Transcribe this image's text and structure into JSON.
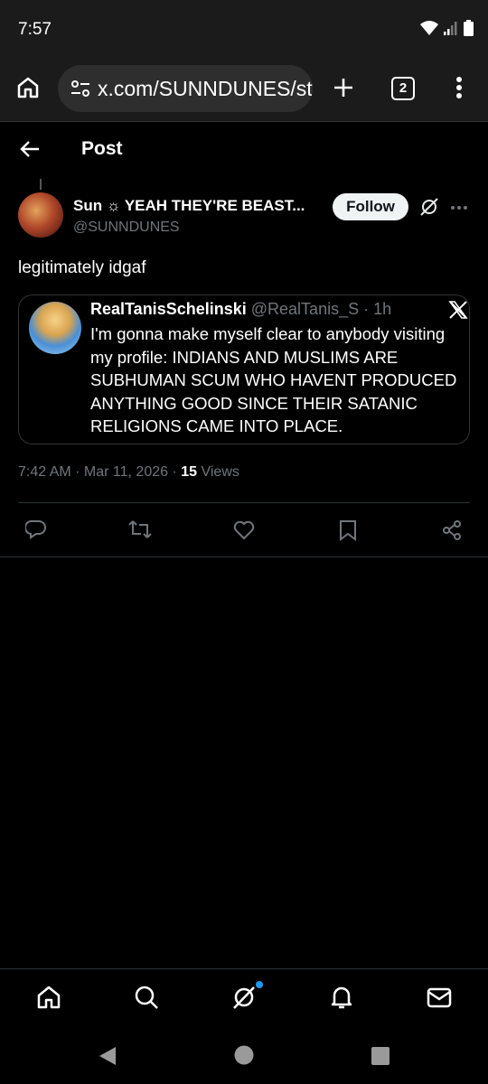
{
  "status": {
    "time": "7:57"
  },
  "browser": {
    "url": "x.com/SUNNDUNES/status",
    "tab_count": "2"
  },
  "header": {
    "title": "Post"
  },
  "post": {
    "author_name": "Sun ☼ YEAH THEY'RE BEAST...",
    "author_handle": "@SUNNDUNES",
    "follow_label": "Follow",
    "text": "legitimately idgaf",
    "time": "7:42 AM",
    "date": "Mar 11, 2026",
    "views_count": "15",
    "views_label": "Views"
  },
  "quote": {
    "name": "RealTanisSchelinski",
    "handle": "@RealTanis_S",
    "age": "1h",
    "text": "I'm gonna make myself clear to anybody visiting my profile: INDIANS AND MUSLIMS ARE SUBHUMAN SCUM WHO HAVENT PRODUCED ANYTHING GOOD SINCE THEIR SATANIC RELIGIONS CAME INTO PLACE."
  },
  "colors": {
    "background": "#000000",
    "secondary_text": "#71767b",
    "accent": "#1d9bf0"
  }
}
